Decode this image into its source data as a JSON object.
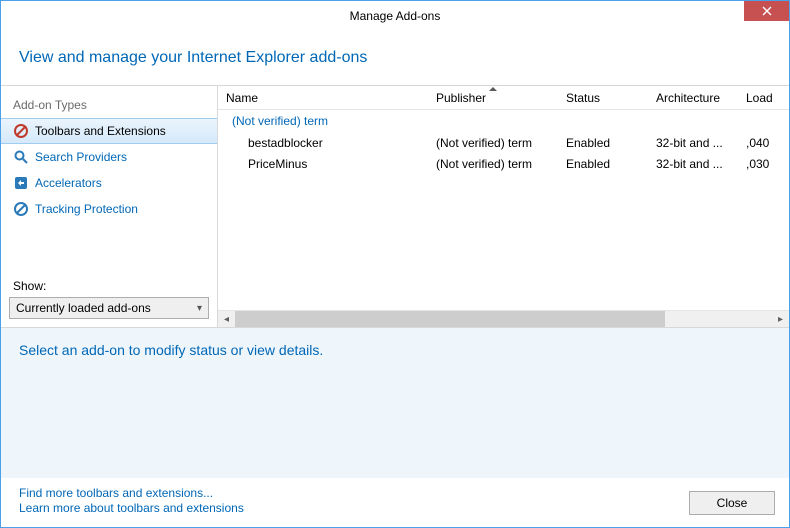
{
  "title": "Manage Add-ons",
  "header": "View and manage your Internet Explorer add-ons",
  "sidebar": {
    "heading": "Add-on Types",
    "items": [
      {
        "label": "Toolbars and Extensions"
      },
      {
        "label": "Search Providers"
      },
      {
        "label": "Accelerators"
      },
      {
        "label": "Tracking Protection"
      }
    ],
    "show_label": "Show:",
    "show_value": "Currently loaded add-ons"
  },
  "columns": {
    "name": "Name",
    "publisher": "Publisher",
    "status": "Status",
    "architecture": "Architecture",
    "load": "Load"
  },
  "group_label": "(Not verified) term",
  "rows": [
    {
      "name": "bestadblocker",
      "publisher": "(Not verified) term",
      "status": "Enabled",
      "arch": "32-bit and ...",
      "load": ",040"
    },
    {
      "name": "PriceMinus",
      "publisher": "(Not verified) term",
      "status": "Enabled",
      "arch": "32-bit and ...",
      "load": ",030"
    }
  ],
  "details_msg": "Select an add-on to modify status or view details.",
  "footer": {
    "link1": "Find more toolbars and extensions...",
    "link2": "Learn more about toolbars and extensions",
    "close": "Close"
  }
}
